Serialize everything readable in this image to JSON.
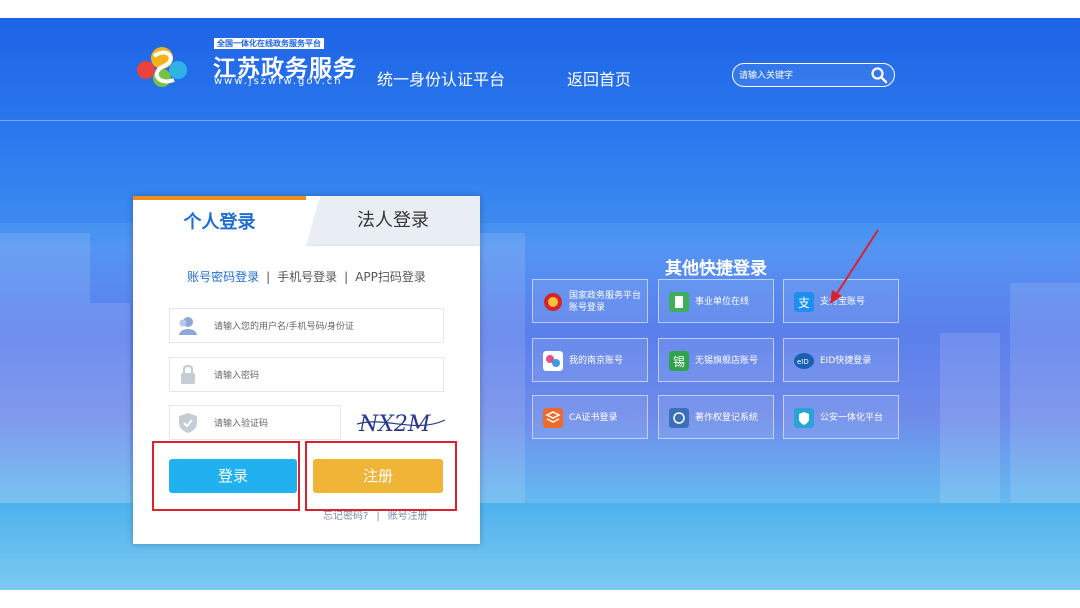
{
  "header": {
    "brand_tag": "全国一体化在线政务服务平台",
    "brand_name": "江苏政务服务",
    "brand_url": "www.jszwfw.gov.cn",
    "nav_auth": "统一身份认证平台",
    "nav_home": "返回首页",
    "search_placeholder": "请输入关键字"
  },
  "login": {
    "tab_personal": "个人登录",
    "tab_legal": "法人登录",
    "subtab_account": "账号密码登录",
    "subtab_phone": "手机号登录",
    "subtab_app": "APP扫码登录",
    "separator": "|",
    "username_placeholder": "请输入您的用户名/手机号码/身份证",
    "password_placeholder": "请输入密码",
    "captcha_placeholder": "请输入验证码",
    "captcha_text": "NX2M",
    "login_button": "登录",
    "register_button": "注册",
    "forgot_link": "忘记密码?",
    "account_register_link": "账号注册"
  },
  "quick": {
    "title": "其他快捷登录",
    "tiles": [
      {
        "label": "国家政务服务平台账号登录",
        "icon": "national-emblem-icon",
        "color": "#d8232a"
      },
      {
        "label": "事业单位在线",
        "icon": "building-icon",
        "color": "#3cae5c"
      },
      {
        "label": "支付宝账号",
        "icon": "alipay-icon",
        "color": "#1b8ff2"
      },
      {
        "label": "我的南京账号",
        "icon": "nanjing-icon",
        "color": "#e04f8a"
      },
      {
        "label": "无锡旗舰店账号",
        "icon": "wuxi-icon",
        "color": "#2fa24c"
      },
      {
        "label": "EID快捷登录",
        "icon": "eid-icon",
        "color": "#1a5fb4"
      },
      {
        "label": "CA证书登录",
        "icon": "ca-cert-icon",
        "color": "#ee6a2a"
      },
      {
        "label": "著作权登记系统",
        "icon": "copyright-icon",
        "color": "#3b6fb8"
      },
      {
        "label": "公安一体化平台",
        "icon": "police-icon",
        "color": "#2aa3d8"
      }
    ]
  },
  "colors": {
    "accent_blue": "#1f6ed4",
    "login_button": "#22b1f0",
    "register_button": "#f0b436",
    "highlight_red": "#d8232a",
    "tab_top_orange": "#f08c1e"
  }
}
